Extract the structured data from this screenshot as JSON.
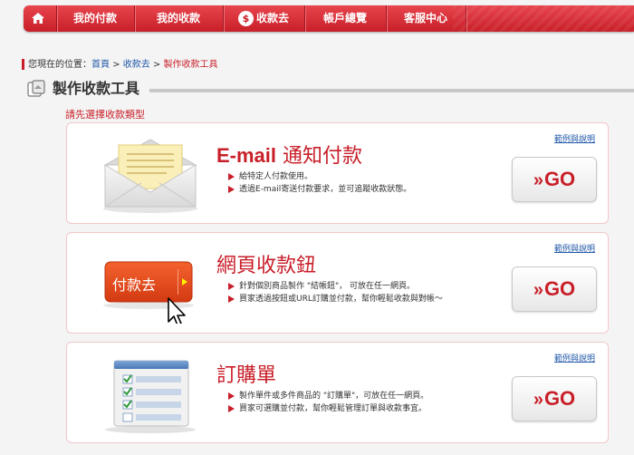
{
  "nav": {
    "items": [
      {
        "label": "我的付款"
      },
      {
        "label": "我的收款"
      },
      {
        "label": "收款去"
      },
      {
        "label": "帳戶總覽"
      },
      {
        "label": "客服中心"
      }
    ]
  },
  "breadcrumb": {
    "prefix": "您現在的位置：",
    "links": [
      "首頁",
      "收款去"
    ],
    "separator": " > ",
    "current": "製作收款工具"
  },
  "page_title": "製作收款工具",
  "hint": "請先選擇收款類型",
  "cards": [
    {
      "title_latin": "E-mail",
      "title": "通知付款",
      "bullets": [
        "給特定人付款使用。",
        "透過E-mail寄送付款要求，並可追蹤收款狀態。"
      ],
      "example": "範例與說明",
      "go": "GO"
    },
    {
      "title_latin": "",
      "title": "網頁收款鈕",
      "button_label": "付款去",
      "bullets": [
        "針對個別商品製作 \"結帳鈕\"， 可放在任一網頁。",
        "買家透過按鈕或URL訂購並付款，幫你輕鬆收款與對帳～"
      ],
      "example": "範例與說明",
      "go": "GO"
    },
    {
      "title_latin": "",
      "title": "訂購單",
      "bullets": [
        "製作單件或多件商品的 \"訂購單\"，可放在任一網頁。",
        "買家可選購並付款，幫你輕鬆管理訂單與收款事宜。"
      ],
      "example": "範例與說明",
      "go": "GO"
    }
  ],
  "colors": {
    "brand_red": "#c81f29",
    "link_blue": "#1f57a8"
  },
  "icons": [
    "home-icon",
    "coin-icon",
    "page-title-icon",
    "envelope-icon",
    "cursor-icon",
    "order-form-icon",
    "double-chevron-icon"
  ]
}
